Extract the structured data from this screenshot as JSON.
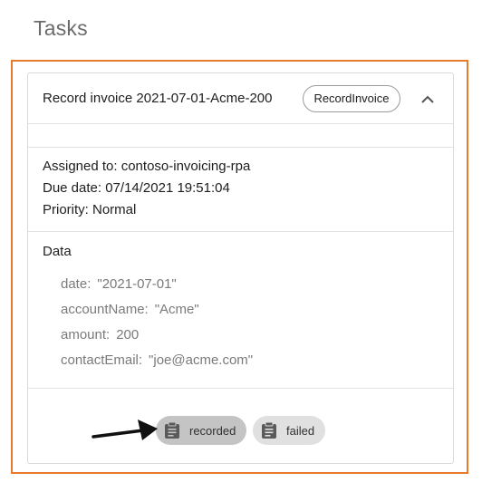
{
  "page": {
    "title": "Tasks"
  },
  "task": {
    "name": "Record invoice 2021-07-01-Acme-200",
    "type_chip": "RecordInvoice",
    "assigned_to": "Assigned to: contoso-invoicing-rpa",
    "due_date": "Due date: 07/14/2021 19:51:04",
    "priority": "Priority: Normal",
    "data_heading": "Data",
    "data": [
      {
        "key": "date:",
        "value": "\"2021-07-01\""
      },
      {
        "key": "accountName:",
        "value": "\"Acme\""
      },
      {
        "key": "amount:",
        "value": "200"
      },
      {
        "key": "contactEmail:",
        "value": "\"joe@acme.com\""
      }
    ],
    "tags": [
      {
        "label": "recorded",
        "icon": "clipboard-icon",
        "selected": true
      },
      {
        "label": "failed",
        "icon": "clipboard-icon",
        "selected": false
      }
    ]
  },
  "colors": {
    "highlight": "#e87a2e",
    "tag_selected": "#c4c4c4",
    "tag_default": "#e0e0e0"
  },
  "icons": {
    "collapse": "chevron-up-icon",
    "annotation": "arrow-right-icon"
  }
}
